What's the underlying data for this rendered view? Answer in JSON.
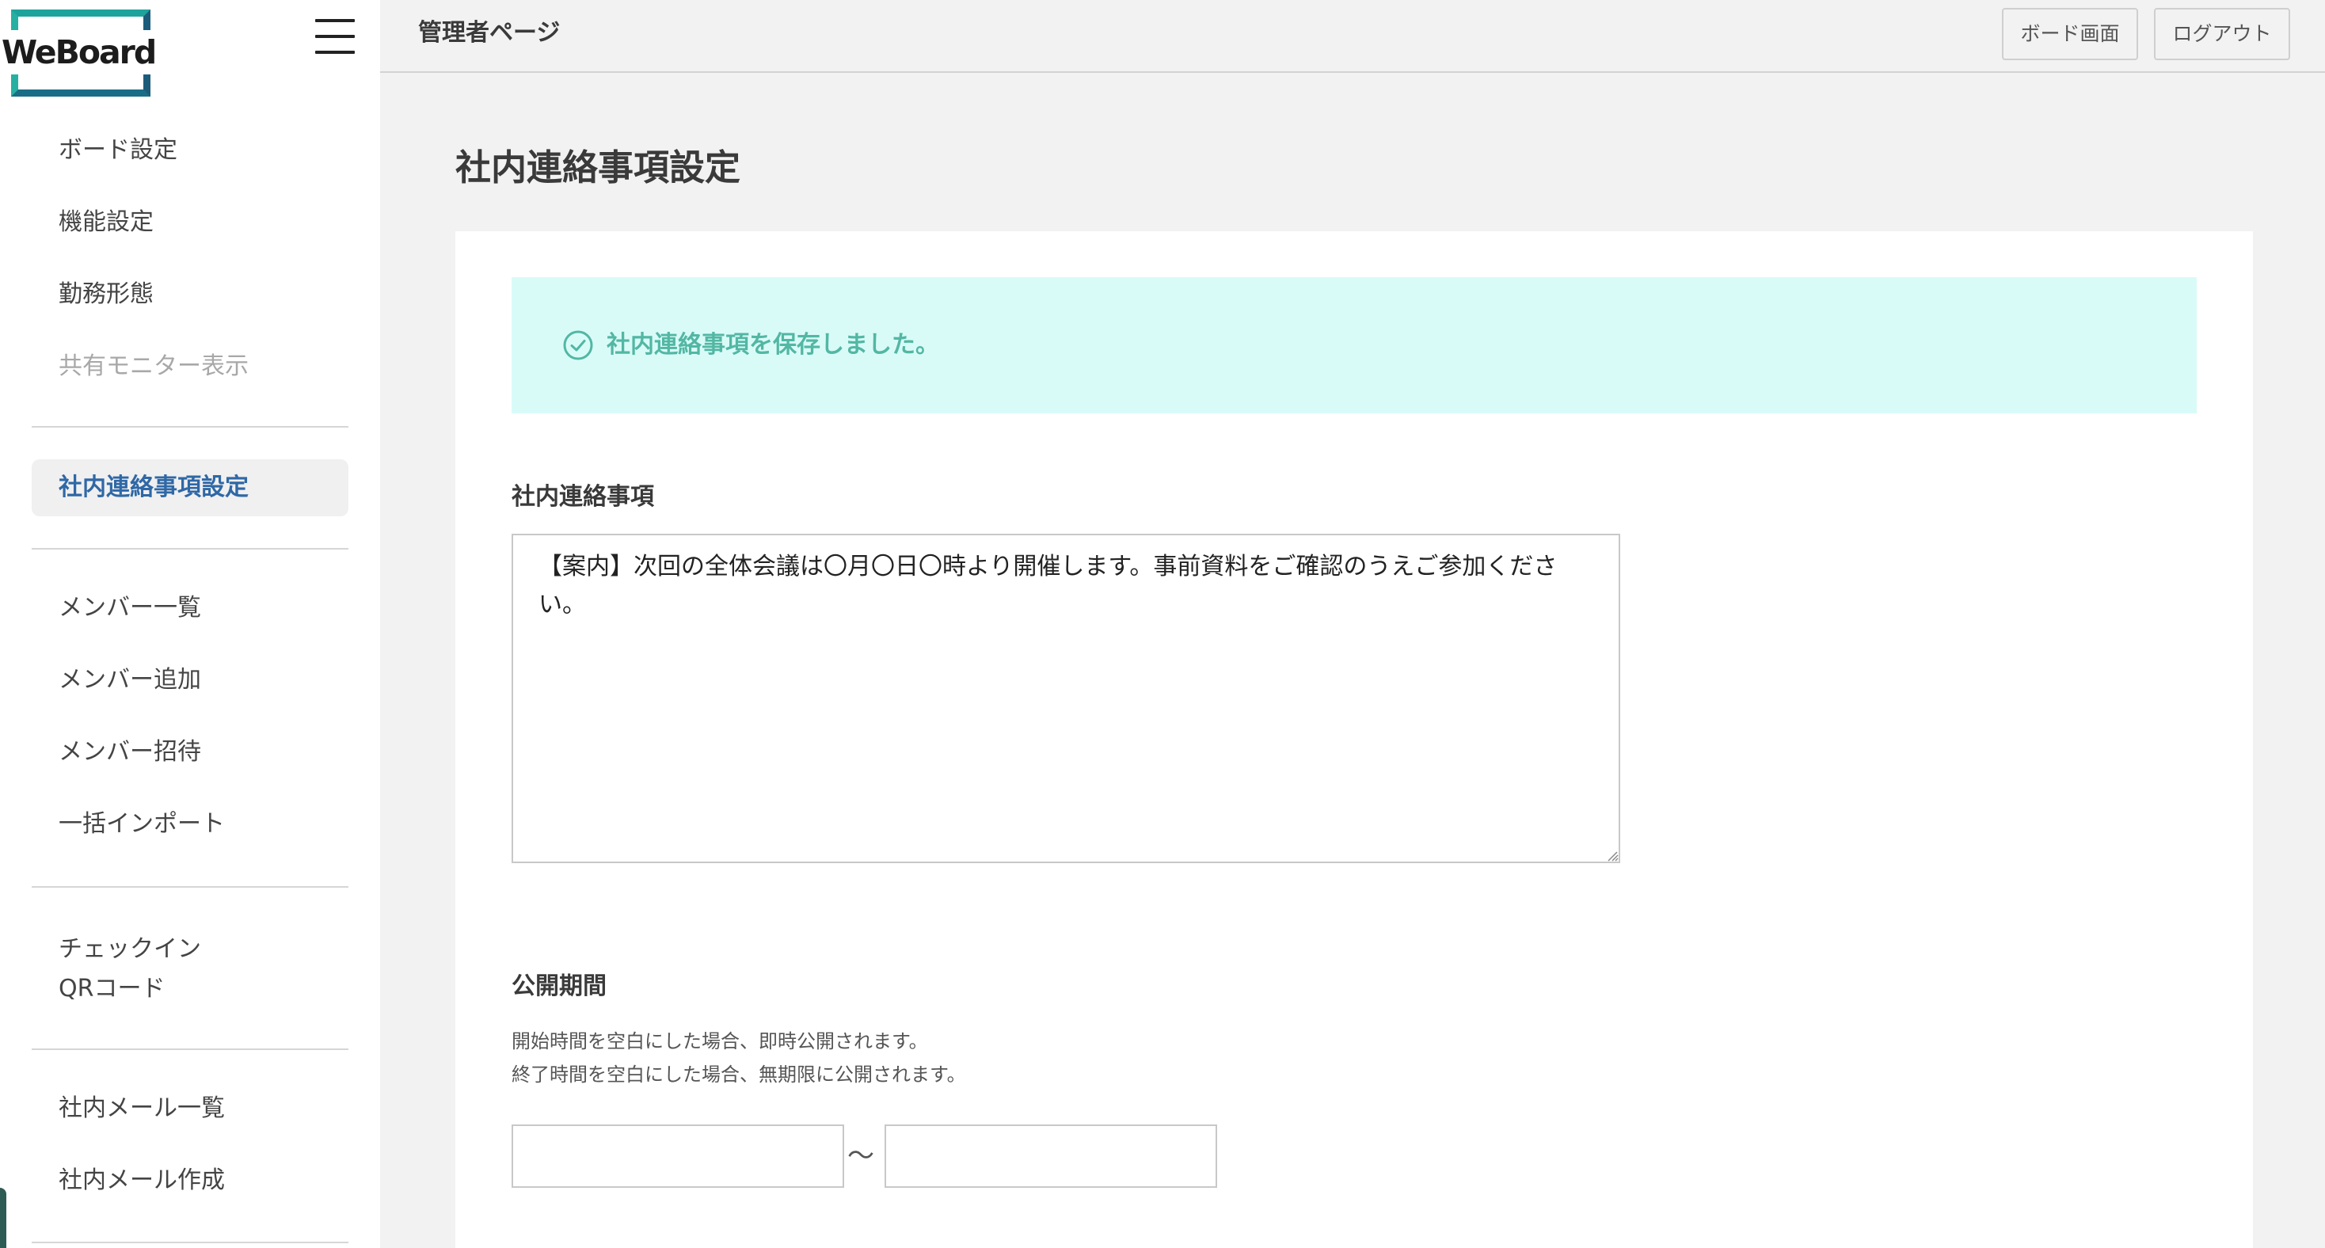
{
  "logo": {
    "text": "WeBoard"
  },
  "header": {
    "title": "管理者ページ",
    "board_button": "ボード画面",
    "logout_button": "ログアウト"
  },
  "sidebar": {
    "items": [
      {
        "label": "ボード設定",
        "state": "normal"
      },
      {
        "label": "機能設定",
        "state": "normal"
      },
      {
        "label": "勤務形態",
        "state": "normal"
      },
      {
        "label": "共有モニター表示",
        "state": "disabled"
      },
      {
        "label": "社内連絡事項設定",
        "state": "active"
      },
      {
        "label": "メンバー一覧",
        "state": "normal"
      },
      {
        "label": "メンバー追加",
        "state": "normal"
      },
      {
        "label": "メンバー招待",
        "state": "normal"
      },
      {
        "label": "一括インポート",
        "state": "normal"
      },
      {
        "label_line1": "チェックイン",
        "label_line2": "QRコード",
        "state": "normal"
      },
      {
        "label": "社内メール一覧",
        "state": "normal"
      },
      {
        "label": "社内メール作成",
        "state": "normal"
      }
    ]
  },
  "main": {
    "page_title": "社内連絡事項設定",
    "alert": {
      "text": "社内連絡事項を保存しました。",
      "icon": "check-circle-icon"
    },
    "notice": {
      "label": "社内連絡事項",
      "value": "【案内】次回の全体会議は〇月〇日〇時より開催します。事前資料をご確認のうえご参加ください。"
    },
    "period": {
      "label": "公開期間",
      "help_line1": "開始時間を空白にした場合、即時公開されます。",
      "help_line2": "終了時間を空白にした場合、無期限に公開されます。",
      "start_value": "",
      "end_value": "",
      "separator": "〜"
    }
  },
  "colors": {
    "accent": "#2f68a6",
    "success_bg": "#d9fbf8",
    "success_text": "#52b7a3"
  }
}
